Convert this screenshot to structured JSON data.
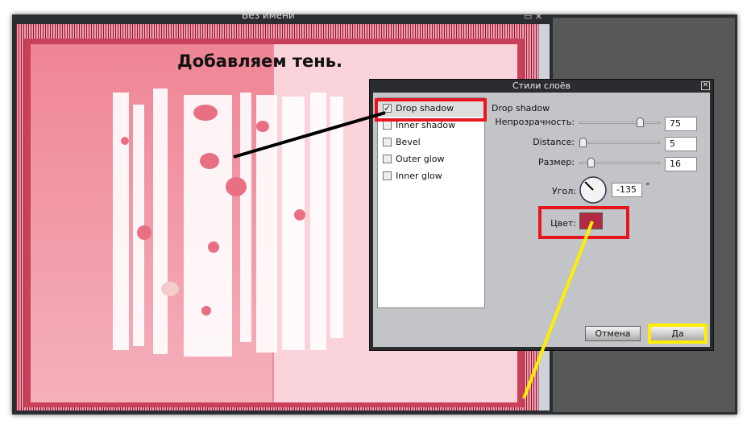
{
  "window": {
    "title": "Без имени",
    "buttons": [
      "restore",
      "close"
    ]
  },
  "canvas": {
    "heading": "Добавляем тень."
  },
  "dialog": {
    "title": "Стили слоёв",
    "effects": [
      {
        "label": "Drop shadow",
        "checked": true
      },
      {
        "label": "Inner shadow",
        "checked": false
      },
      {
        "label": "Bevel",
        "checked": false
      },
      {
        "label": "Outer glow",
        "checked": false
      },
      {
        "label": "Inner glow",
        "checked": false
      }
    ],
    "section_title": "Drop shadow",
    "opacity": {
      "label": "Непрозрачность:",
      "value": "75"
    },
    "distance": {
      "label": "Distance:",
      "value": "5"
    },
    "size": {
      "label": "Размер:",
      "value": "16"
    },
    "angle": {
      "label": "Угол:",
      "value": "-135",
      "unit": "°"
    },
    "color": {
      "label": "Цвет:",
      "value": "#b22a44"
    },
    "cancel": "Отмена",
    "ok": "Да"
  },
  "annotation_colors": {
    "highlight_red": "#e8141e",
    "highlight_yellow": "#ffee00",
    "pointer_black": "#000000"
  }
}
